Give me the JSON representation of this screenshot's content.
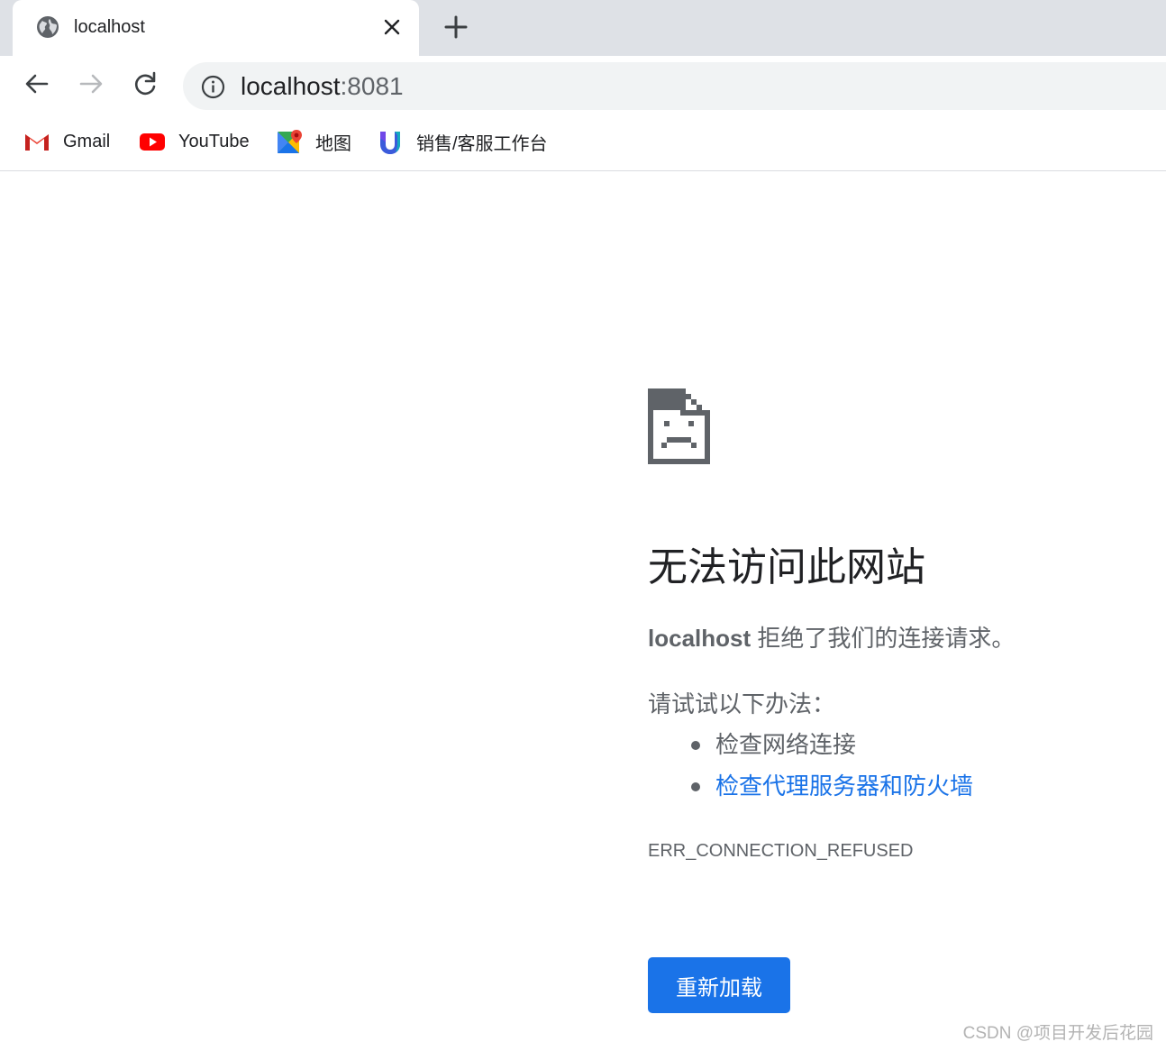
{
  "tab": {
    "title": "localhost",
    "favicon": "globe-icon",
    "close_icon": "close-icon",
    "new_tab_icon": "plus-icon"
  },
  "toolbar": {
    "back_icon": "back-arrow-icon",
    "forward_icon": "forward-arrow-icon",
    "reload_icon": "reload-icon",
    "info_icon": "info-icon",
    "url_host": "localhost",
    "url_port": ":8081"
  },
  "bookmarks": [
    {
      "label": "Gmail",
      "icon": "gmail-icon"
    },
    {
      "label": "YouTube",
      "icon": "youtube-icon"
    },
    {
      "label": "地图",
      "icon": "maps-icon"
    },
    {
      "label": "销售/客服工作台",
      "icon": "workbench-icon"
    }
  ],
  "error": {
    "icon": "sad-page-icon",
    "title": "无法访问此网站",
    "host": "localhost",
    "message": " 拒绝了我们的连接请求。",
    "suggest_title": "请试试以下办法：",
    "suggestions": [
      {
        "text": "检查网络连接",
        "link": false
      },
      {
        "text": "检查代理服务器和防火墙",
        "link": true
      }
    ],
    "code": "ERR_CONNECTION_REFUSED",
    "reload_label": "重新加载"
  },
  "watermark": "CSDN @项目开发后花园",
  "colors": {
    "accent": "#1a73e8",
    "tabstrip": "#dee1e6",
    "omnibox": "#f1f3f4",
    "muted_text": "#5f6368"
  }
}
